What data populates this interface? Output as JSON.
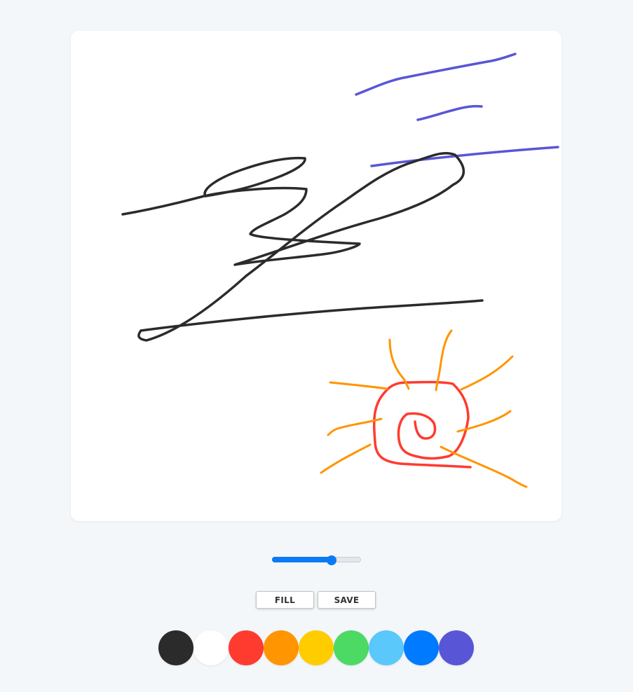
{
  "brush": {
    "size_fraction": 0.67,
    "accent_color": "#0a7bf5"
  },
  "toolbar": {
    "fill_label": "FILL",
    "save_label": "SAVE"
  },
  "palette": [
    {
      "name": "black",
      "color": "#2b2b2b"
    },
    {
      "name": "white",
      "color": "#ffffff"
    },
    {
      "name": "red",
      "color": "#ff3b30"
    },
    {
      "name": "orange",
      "color": "#ff9500"
    },
    {
      "name": "yellow",
      "color": "#ffcc00"
    },
    {
      "name": "green",
      "color": "#4cd964"
    },
    {
      "name": "light-blue",
      "color": "#5ac8fa"
    },
    {
      "name": "blue",
      "color": "#007aff"
    },
    {
      "name": "purple",
      "color": "#5856d6"
    }
  ],
  "strokes": {
    "black": "#2b2b2b",
    "purple": "#5856d6",
    "red": "#ff3b30",
    "orange": "#ff9500"
  }
}
